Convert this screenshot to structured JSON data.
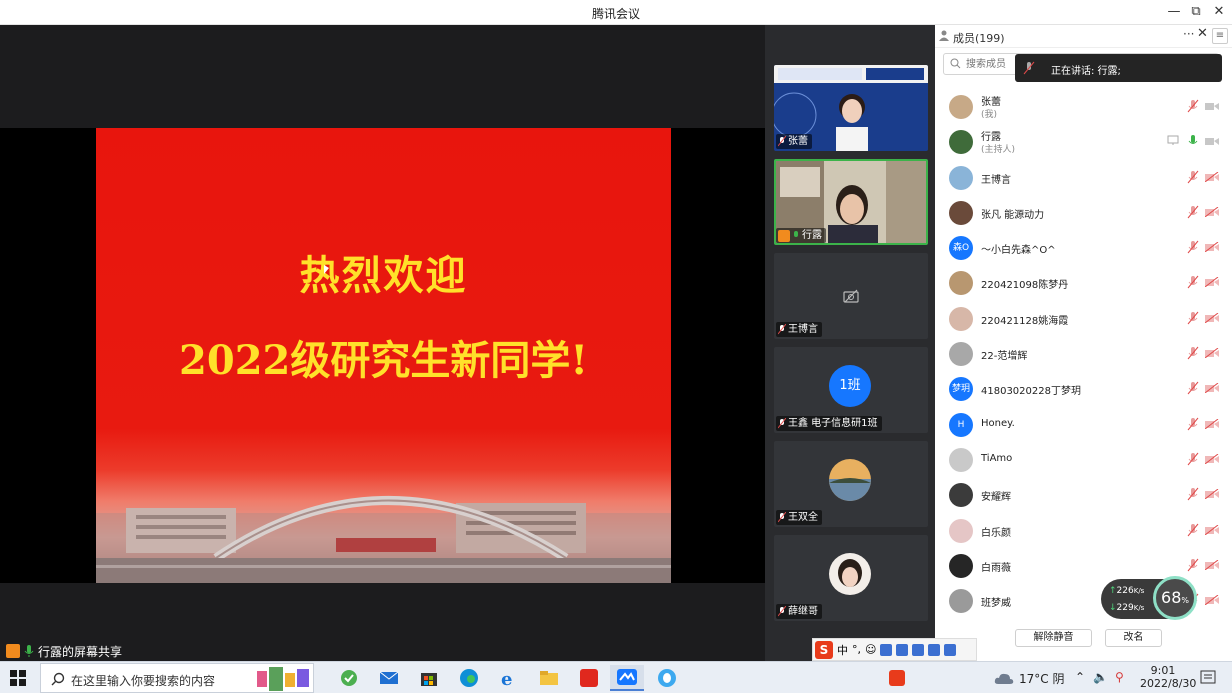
{
  "window": {
    "title": "腾讯会议",
    "minimize": "—",
    "restore": "⧉",
    "close": "✕"
  },
  "share": {
    "slide_line1": "热烈欢迎",
    "slide_line2": "2022级研究生新同学!",
    "label": "行露的屏幕共享"
  },
  "video_tiles": [
    {
      "name": "张蕾"
    },
    {
      "name": "行露"
    },
    {
      "name": "王博言"
    },
    {
      "name": "王鑫 电子信息研1班",
      "badge": "1班"
    },
    {
      "name": "王双全"
    },
    {
      "name": "薛继哥"
    }
  ],
  "panel": {
    "title": "成员(199)",
    "more": "···",
    "close": "✕",
    "menu": "≡",
    "search_placeholder": "搜索成员",
    "speaking": "正在讲话: 行露;",
    "buttons": {
      "unmute_all": "解除静音",
      "rename": "改名"
    }
  },
  "members": [
    {
      "name": "张蕾",
      "sub": "(我)",
      "avatar_color": "#c7a987"
    },
    {
      "name": "行露",
      "sub": "(主持人)",
      "avatar_color": "#3f6b3a",
      "host": true
    },
    {
      "name": "王博言",
      "avatar_color": "#8ab4d8"
    },
    {
      "name": "张凡 能源动力",
      "avatar_color": "#6a4a3a"
    },
    {
      "name": "～小白先森^O^",
      "avatar_text": "森O",
      "avatar_color": "#1677ff"
    },
    {
      "name": "220421098陈梦丹",
      "avatar_color": "#b89770"
    },
    {
      "name": "220421128姚海霞",
      "avatar_color": "#d7b7a8"
    },
    {
      "name": "22-范增辉",
      "avatar_color": "#a8a8a8"
    },
    {
      "name": "41803020228丁梦玥",
      "avatar_text": "梦玥",
      "avatar_color": "#1677ff"
    },
    {
      "name": "Honey.",
      "avatar_text": "H",
      "avatar_color": "#1677ff"
    },
    {
      "name": "TiAmo",
      "avatar_color": "#c9c9c9"
    },
    {
      "name": "安耀辉",
      "avatar_color": "#3b3b3b"
    },
    {
      "name": "白乐颜",
      "avatar_color": "#e5c6c6"
    },
    {
      "name": "白雨薇",
      "avatar_color": "#262626"
    },
    {
      "name": "班梦威",
      "avatar_color": "#9a9a9a"
    }
  ],
  "network": {
    "up": "226",
    "down": "229",
    "unit": "K/s",
    "cpu": "68",
    "cpu_unit": "%"
  },
  "ime": {
    "mode": "中",
    "punct": "°,"
  },
  "taskbar": {
    "search_placeholder": "在这里输入你要搜索的内容",
    "weather": "17°C 阴",
    "time": "9:01",
    "date": "2022/8/30"
  },
  "colors": {
    "slide_red": "#e8150d",
    "slide_text": "#ffe12a",
    "active_border": "#3cb34a",
    "accent_blue": "#1677ff"
  }
}
